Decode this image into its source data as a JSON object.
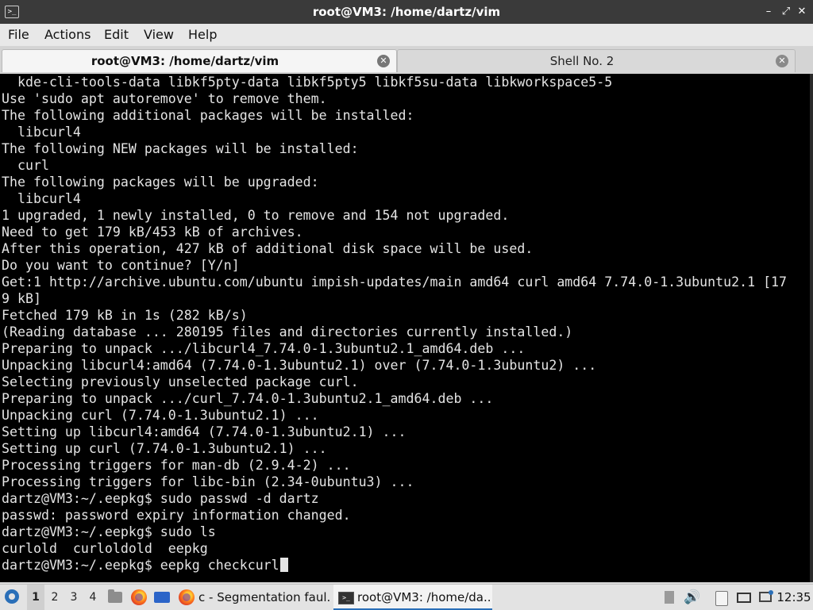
{
  "window": {
    "title": "root@VM3: /home/dartz/vim",
    "app_icon": "terminal-icon",
    "controls": {
      "minimize": "–",
      "maximize": "⤢",
      "close": "✕"
    }
  },
  "menubar": {
    "items": [
      "File",
      "Actions",
      "Edit",
      "View",
      "Help"
    ]
  },
  "tabs": [
    {
      "label": "root@VM3: /home/dartz/vim",
      "active": true,
      "close_icon": "close-icon"
    },
    {
      "label": "Shell No. 2",
      "active": false,
      "close_icon": "close-icon"
    }
  ],
  "terminal": {
    "lines": [
      "  kde-cli-tools-data libkf5pty-data libkf5pty5 libkf5su-data libkworkspace5-5",
      "Use 'sudo apt autoremove' to remove them.",
      "The following additional packages will be installed:",
      "  libcurl4",
      "The following NEW packages will be installed:",
      "  curl",
      "The following packages will be upgraded:",
      "  libcurl4",
      "1 upgraded, 1 newly installed, 0 to remove and 154 not upgraded.",
      "Need to get 179 kB/453 kB of archives.",
      "After this operation, 427 kB of additional disk space will be used.",
      "Do you want to continue? [Y/n]",
      "Get:1 http://archive.ubuntu.com/ubuntu impish-updates/main amd64 curl amd64 7.74.0-1.3ubuntu2.1 [17",
      "9 kB]",
      "Fetched 179 kB in 1s (282 kB/s)",
      "(Reading database ... 280195 files and directories currently installed.)",
      "Preparing to unpack .../libcurl4_7.74.0-1.3ubuntu2.1_amd64.deb ...",
      "Unpacking libcurl4:amd64 (7.74.0-1.3ubuntu2.1) over (7.74.0-1.3ubuntu2) ...",
      "Selecting previously unselected package curl.",
      "Preparing to unpack .../curl_7.74.0-1.3ubuntu2.1_amd64.deb ...",
      "Unpacking curl (7.74.0-1.3ubuntu2.1) ...",
      "Setting up libcurl4:amd64 (7.74.0-1.3ubuntu2.1) ...",
      "Setting up curl (7.74.0-1.3ubuntu2.1) ...",
      "Processing triggers for man-db (2.9.4-2) ...",
      "Processing triggers for libc-bin (2.34-0ubuntu3) ...",
      "dartz@VM3:~/.eepkg$ sudo passwd -d dartz",
      "passwd: password expiry information changed.",
      "dartz@VM3:~/.eepkg$ sudo ls",
      "curlold  curloldold  eepkg",
      "dartz@VM3:~/.eepkg$ eepkg checkcurl"
    ],
    "background": "#000000",
    "foreground": "#e4e4e4"
  },
  "taskbar": {
    "start_icon": "menu-icon",
    "workspaces": [
      "1",
      "2",
      "3",
      "4"
    ],
    "active_workspace": "1",
    "launchers": [
      "file-manager-icon",
      "firefox-icon",
      "screen-icon"
    ],
    "tasks": [
      {
        "label": "c - Segmentation faul...",
        "icon": "firefox-icon"
      },
      {
        "label": "root@VM3: /home/da...",
        "icon": "terminal-icon",
        "active": true
      }
    ],
    "tray": [
      "trash-icon",
      "volume-icon",
      "clipboard-icon",
      "keyboard-icon",
      "network-icon"
    ],
    "volume_glyph": "🔊",
    "clock": "12:35",
    "accent": "#2a6fb8"
  }
}
